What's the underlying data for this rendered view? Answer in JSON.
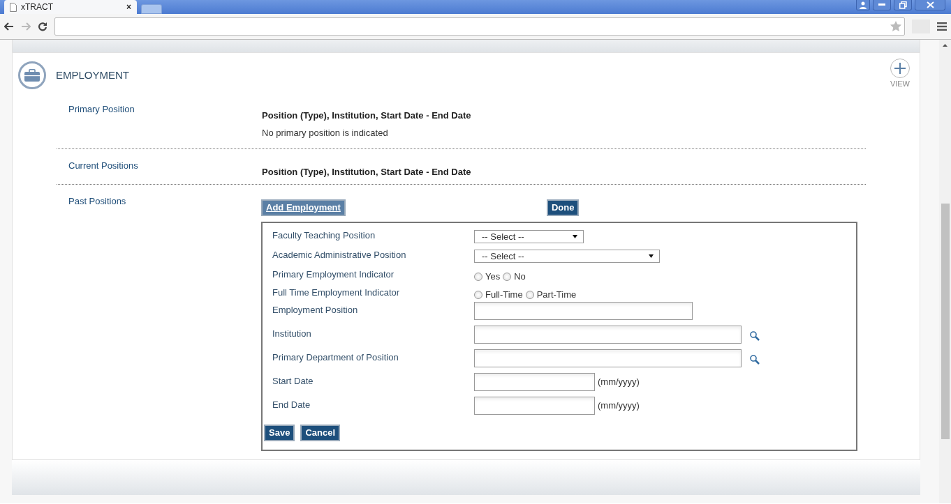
{
  "browser": {
    "tab_title": "xTRACT",
    "tab_close": "×"
  },
  "section": {
    "title": "EMPLOYMENT",
    "view_label": "VIEW"
  },
  "rows": [
    {
      "label": "Primary Position",
      "heading": "Position (Type), Institution, Start Date - End Date",
      "note": "No primary position is indicated"
    },
    {
      "label": "Current Positions",
      "heading": "Position (Type), Institution, Start Date - End Date"
    },
    {
      "label": "Past Positions"
    }
  ],
  "buttons": {
    "add": "Add Employment",
    "done": "Done"
  },
  "form": {
    "fields": [
      {
        "kind": "select",
        "label": "Faculty Teaching Position",
        "value": "-- Select --"
      },
      {
        "kind": "select",
        "label": "Academic Administrative Position",
        "value": "-- Select --"
      },
      {
        "kind": "radio",
        "label": "Primary Employment Indicator",
        "options": [
          {
            "label": "Yes",
            "selected": false
          },
          {
            "label": "No",
            "selected": false
          }
        ]
      },
      {
        "kind": "radio",
        "label": "Full Time Employment Indicator",
        "options": [
          {
            "label": "Full-Time",
            "selected": false
          },
          {
            "label": "Part-Time",
            "selected": false
          }
        ]
      },
      {
        "kind": "text",
        "label": "Employment Position"
      },
      {
        "kind": "lookup",
        "label": "Institution"
      },
      {
        "kind": "lookup",
        "label": "Primary Department of Position"
      },
      {
        "kind": "date",
        "label": "Start Date",
        "hint": "(mm/yyyy)"
      },
      {
        "kind": "date",
        "label": "End Date",
        "hint": "(mm/yyyy)"
      }
    ],
    "actions": [
      "Save",
      "Cancel"
    ]
  }
}
